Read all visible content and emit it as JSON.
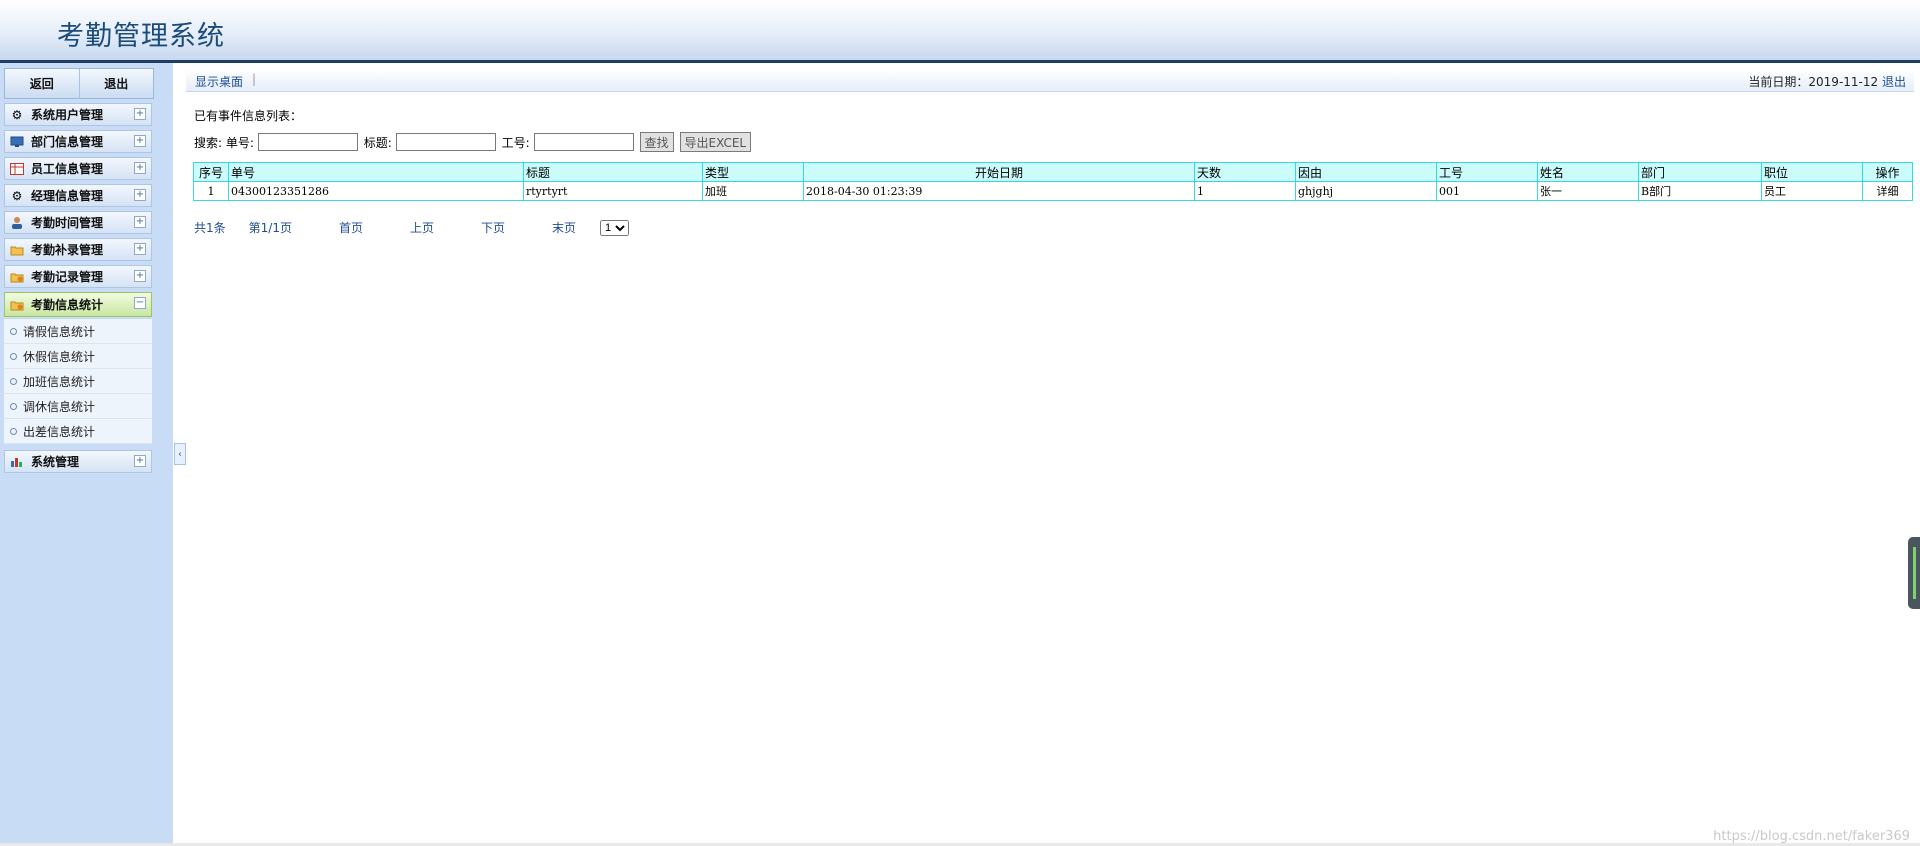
{
  "header": {
    "title": "考勤管理系统"
  },
  "sidebar": {
    "back_label": "返回",
    "logout_label": "退出",
    "groups": [
      {
        "label": "系统用户管理",
        "icon": "gear-icon"
      },
      {
        "label": "部门信息管理",
        "icon": "monitor-icon"
      },
      {
        "label": "员工信息管理",
        "icon": "table-icon"
      },
      {
        "label": "经理信息管理",
        "icon": "gear-icon"
      },
      {
        "label": "考勤时间管理",
        "icon": "user-icon"
      },
      {
        "label": "考勤补录管理",
        "icon": "folder-icon"
      },
      {
        "label": "考勤记录管理",
        "icon": "folder-lock-icon"
      },
      {
        "label": "考勤信息统计",
        "icon": "folder-lock-icon",
        "active": true
      },
      {
        "label": "系统管理",
        "icon": "chart-icon"
      }
    ],
    "subitems": [
      "请假信息统计",
      "休假信息统计",
      "加班信息统计",
      "调休信息统计",
      "出差信息统计"
    ]
  },
  "breadcrumb": {
    "link": "显示桌面",
    "date_label": "当前日期：2019-11-12",
    "logout": "退出"
  },
  "main": {
    "list_title": "已有事件信息列表：",
    "search": {
      "label": "搜索:",
      "order_label": "单号:",
      "title_label": "标题:",
      "emp_label": "工号:",
      "find_button": "查找",
      "export_button": "导出EXCEL"
    },
    "table": {
      "headers": [
        "序号",
        "单号",
        "标题",
        "类型",
        "开始日期",
        "天数",
        "因由",
        "工号",
        "姓名",
        "部门",
        "职位",
        "操作"
      ],
      "rows": [
        [
          "1",
          "04300123351286",
          "rtyrtyrt",
          "加班",
          "2018-04-30 01:23:39",
          "1",
          "ghjghj",
          "001",
          "张一",
          "B部门",
          "员工",
          "详细"
        ]
      ]
    },
    "pager": {
      "total": "共1条",
      "page": "第1/1页",
      "first": "首页",
      "prev": "上页",
      "next": "下页",
      "last": "末页",
      "select_value": "1"
    }
  },
  "watermark": "https://blog.csdn.net/faker369"
}
